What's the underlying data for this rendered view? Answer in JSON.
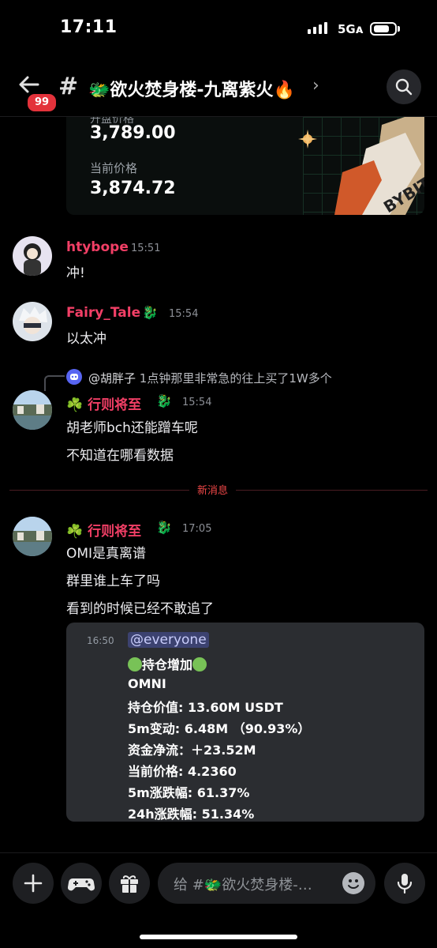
{
  "status_bar": {
    "time": "17:11",
    "network": "5Gᴀ"
  },
  "header": {
    "unread_badge": "99",
    "channel_title": "🐲欲火焚身楼-九离紫火🔥",
    "chevron": "›"
  },
  "price_card": {
    "top_label": "开盘价格",
    "top_value": "3,789.00",
    "current_label": "当前价格",
    "current_value": "3,874.72",
    "brand": "BYBIT"
  },
  "messages": [
    {
      "name": "htybope",
      "name_color": "#f23f66",
      "time": "15:51",
      "lines": [
        "冲!"
      ]
    },
    {
      "name": "Fairy_Tale",
      "name_color": "#f23f66",
      "time": "15:54",
      "lines": [
        "以太冲"
      ]
    },
    {
      "name": "☘️ 行则将至",
      "name_color": "#f23f66",
      "time": "15:54",
      "reply": {
        "mention": "@胡胖子",
        "text": "1点钟那里非常急的往上买了1W多个"
      },
      "lines": [
        "胡老师bch还能蹭车呢",
        "不知道在哪看数据"
      ]
    },
    {
      "name": "☘️ 行则将至",
      "name_color": "#f23f66",
      "time": "17:05",
      "lines": [
        "OMI是真离谱",
        "群里谁上车了吗",
        "看到的时候已经不敢追了"
      ]
    }
  ],
  "divider_label": "新消息",
  "embed": {
    "time": "16:50",
    "mention": "@everyone",
    "heading": "持仓增加",
    "symbol": "OMNI",
    "rows": [
      "持仓价值: 13.60M USDT",
      "5m变动: 6.48M （90.93%）",
      "资金净流：＋23.52M",
      "当前价格: 4.2360",
      "5m涨跌幅: 61.37%",
      "24h涨跌幅: 51.34%"
    ]
  },
  "composer": {
    "placeholder": "给 #🐲欲火焚身楼-…"
  },
  "colors": {
    "accent_name": "#f23f66",
    "badge": "#e3323b",
    "new_divider": "#f04747"
  },
  "icons": [
    "back-arrow-icon",
    "thread-icon",
    "search-icon",
    "plus-icon",
    "gamepad-icon",
    "gift-icon",
    "emoji-icon",
    "microphone-icon",
    "discord-icon",
    "dragon-icon"
  ]
}
